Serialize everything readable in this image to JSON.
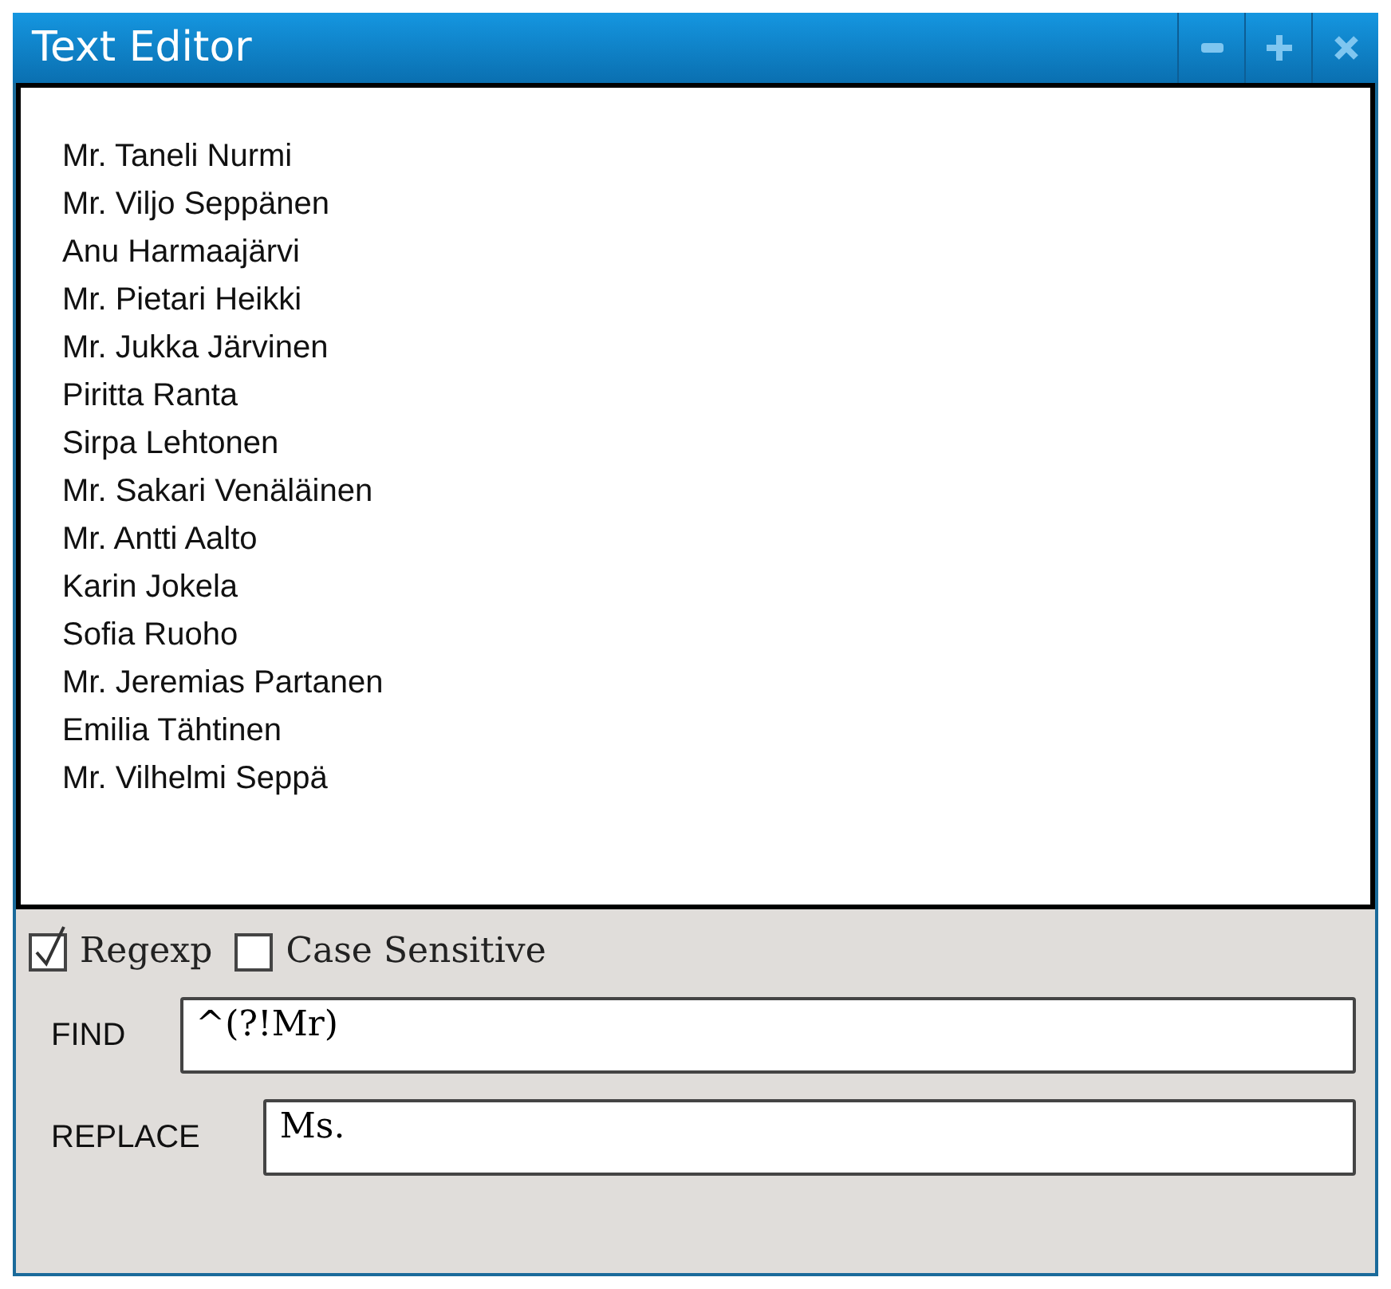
{
  "window": {
    "title": "Text Editor",
    "buttons": [
      {
        "kind": "minimize"
      },
      {
        "kind": "maximize"
      },
      {
        "kind": "close"
      }
    ]
  },
  "editor": {
    "lines": [
      "Mr. Taneli Nurmi",
      "Mr. Viljo Seppänen",
      "Anu Harmaajärvi",
      "Mr. Pietari Heikki",
      "Mr. Jukka Järvinen",
      "Piritta Ranta",
      "Sirpa Lehtonen",
      "Mr. Sakari Venäläinen",
      "Mr. Antti Aalto",
      "Karin Jokela",
      "Sofia Ruoho",
      "Mr. Jeremias Partanen",
      "Emilia Tähtinen",
      "Mr. Vilhelmi Seppä"
    ]
  },
  "options": [
    {
      "label": "Regexp",
      "checked": true
    },
    {
      "label": "Case Sensitive",
      "checked": false
    }
  ],
  "fields": [
    {
      "label": "FIND",
      "value": "^(?!Mr)"
    },
    {
      "label": "REPLACE",
      "value": "Ms."
    }
  ]
}
